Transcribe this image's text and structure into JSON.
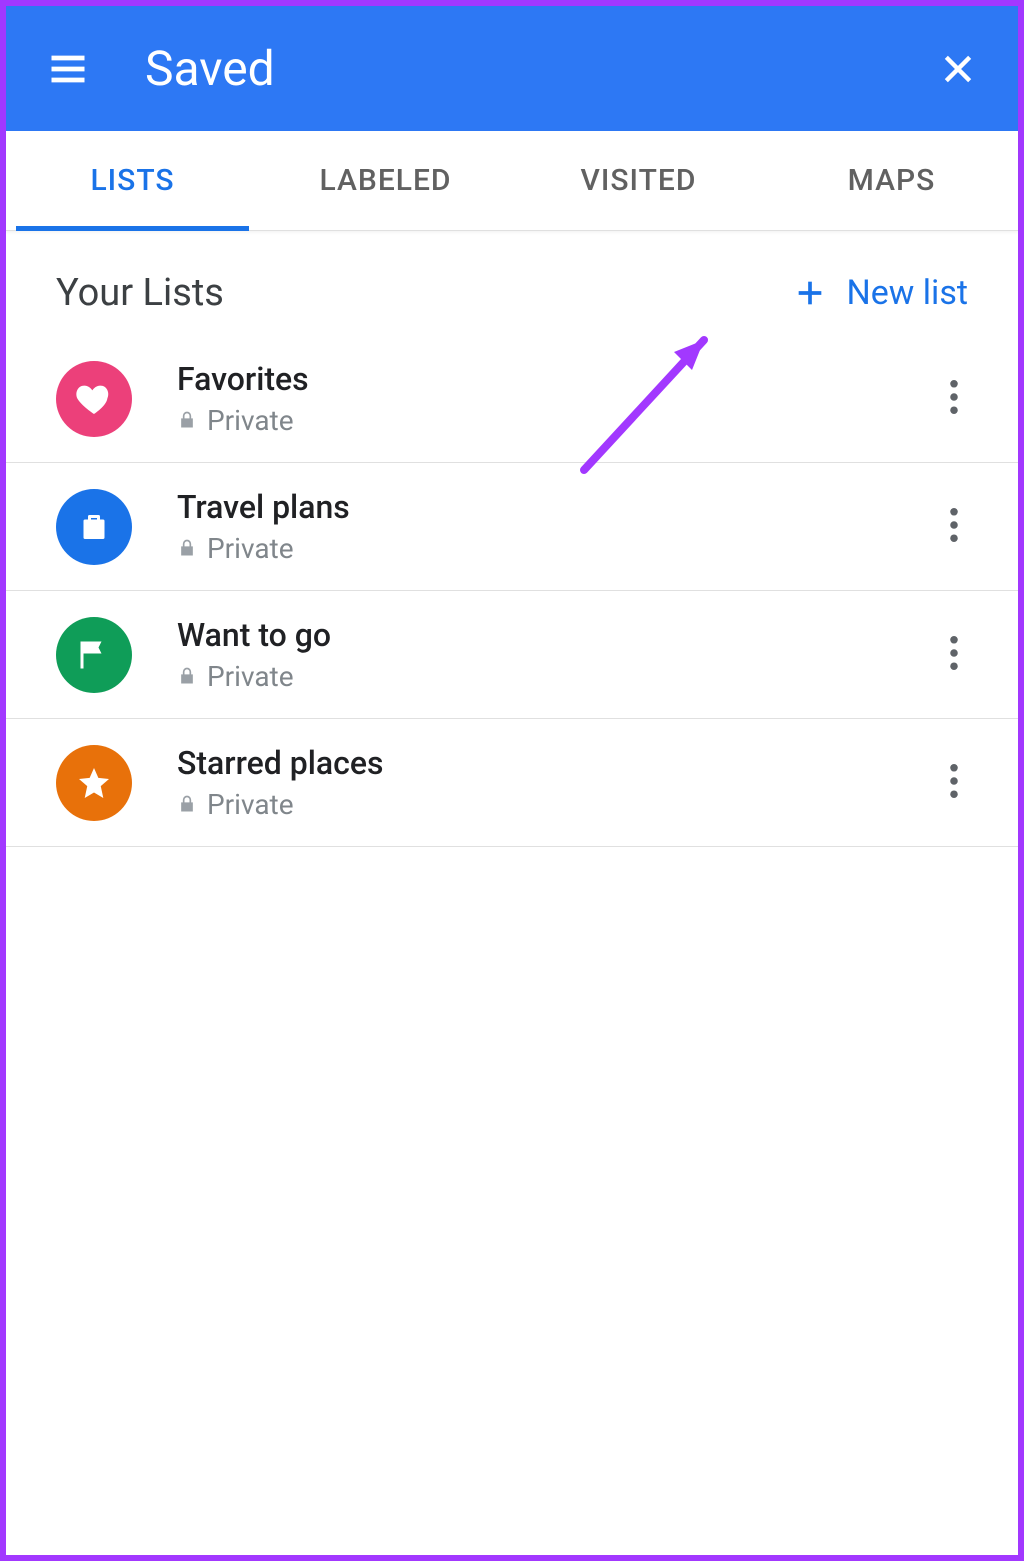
{
  "header": {
    "title": "Saved"
  },
  "tabs": [
    {
      "label": "LISTS",
      "active": true
    },
    {
      "label": "LABELED",
      "active": false
    },
    {
      "label": "VISITED",
      "active": false
    },
    {
      "label": "MAPS",
      "active": false
    }
  ],
  "section": {
    "title": "Your Lists",
    "new_list_label": "New list"
  },
  "lists": [
    {
      "name": "Favorites",
      "privacy": "Private",
      "icon": "heart",
      "color": "#ec407a"
    },
    {
      "name": "Travel plans",
      "privacy": "Private",
      "icon": "suitcase",
      "color": "#1a73e8"
    },
    {
      "name": "Want to go",
      "privacy": "Private",
      "icon": "flag",
      "color": "#0f9d58"
    },
    {
      "name": "Starred places",
      "privacy": "Private",
      "icon": "star",
      "color": "#e8710a"
    }
  ]
}
